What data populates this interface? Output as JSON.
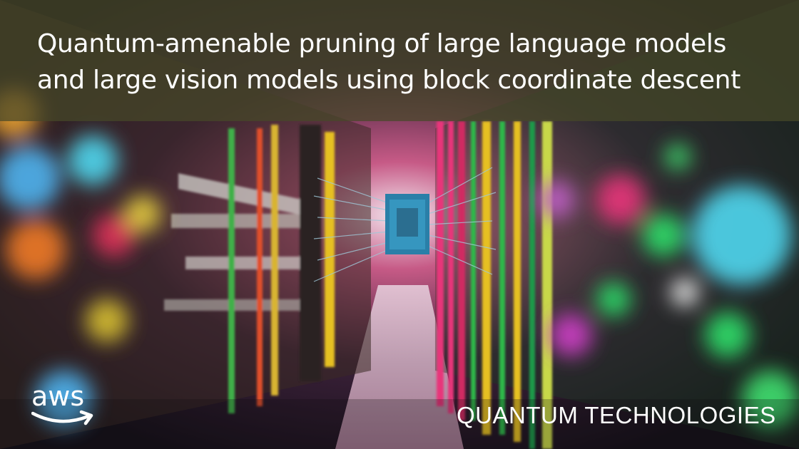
{
  "title": {
    "line1": "Quantum-amenable pruning of large language models",
    "line2": "and large vision models using block coordinate descent"
  },
  "brand": {
    "logo_text": "aws"
  },
  "category": "QUANTUM TECHNOLOGIES",
  "colors": {
    "title_band": "#46482880",
    "text": "#ffffff",
    "cable_pink": "#e8347a",
    "cable_yellow": "#e6c020",
    "cable_green": "#2fb84a",
    "chip_blue": "#2a7fa8",
    "bokeh_cyan": "#4fd8f0"
  }
}
